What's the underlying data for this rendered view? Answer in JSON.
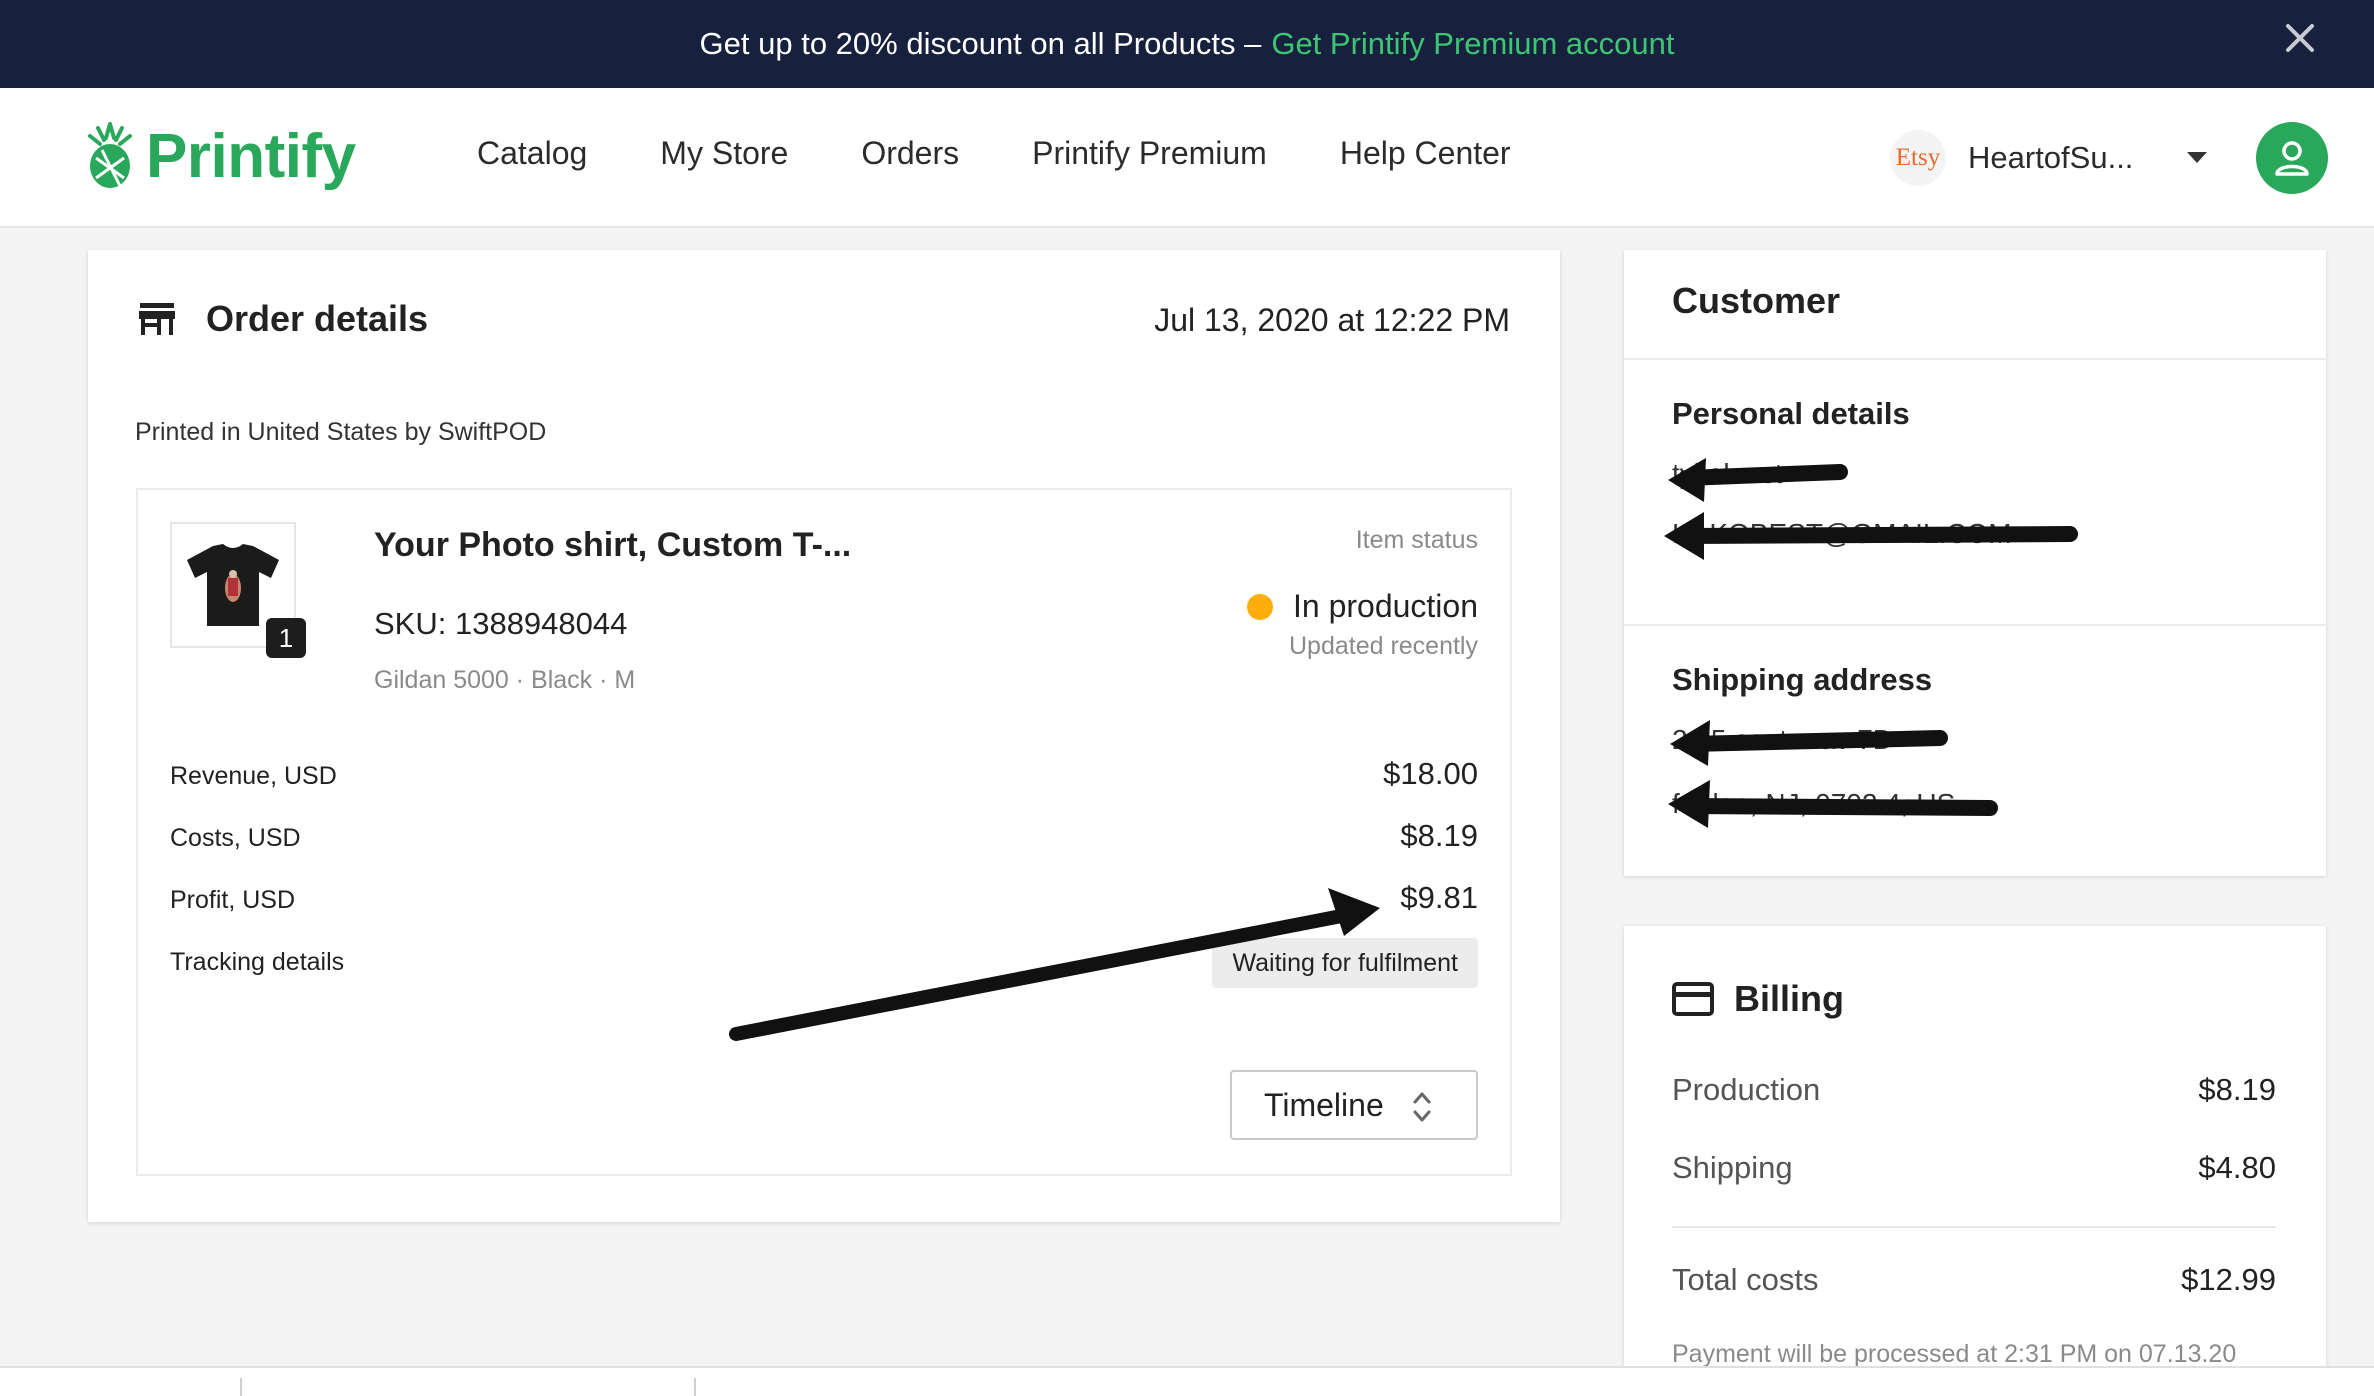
{
  "promo": {
    "text": "Get up to 20% discount on all Products –",
    "link": "Get Printify Premium account"
  },
  "header": {
    "logo": "Printify",
    "nav": [
      "Catalog",
      "My Store",
      "Orders",
      "Printify Premium",
      "Help Center"
    ],
    "store_badge": "Etsy",
    "store_name": "HeartofSu..."
  },
  "order": {
    "title": "Order details",
    "date": "Jul 13, 2020 at 12:22 PM",
    "printed_by": "Printed in United States by SwiftPOD",
    "item": {
      "name": "Your Photo shirt, Custom T-...",
      "sku": "SKU: 1388948044",
      "variant": "Gildan 5000 · Black · M",
      "quantity": "1",
      "status_label": "Item status",
      "status": "In production",
      "status_updated": "Updated recently"
    },
    "financials": {
      "revenue_label": "Revenue, USD",
      "revenue": "$18.00",
      "costs_label": "Costs, USD",
      "costs": "$8.19",
      "profit_label": "Profit, USD",
      "profit": "$9.81",
      "tracking_label": "Tracking details",
      "tracking_status": "Waiting for fulfilment"
    },
    "timeline_label": "Timeline"
  },
  "customer": {
    "title": "Customer",
    "personal_title": "Personal details",
    "name_redacted": "tyl el..est",
    "email_redacted": "KAKOBEST@GMAIL.COM",
    "shipping_title": "Shipping address",
    "address_line1_redacted": "2 55 center av 7D",
    "address_line2_redacted": "f rt lee, NJ, 0702 4, US"
  },
  "billing": {
    "title": "Billing",
    "production_label": "Production",
    "production": "$8.19",
    "shipping_label": "Shipping",
    "shipping": "$4.80",
    "total_label": "Total costs",
    "total": "$12.99",
    "note": "Payment will be processed at 2:31 PM on 07.13.20"
  },
  "colors": {
    "brand_green": "#29a75a",
    "banner_bg": "#17213d",
    "status_dot": "#ffad0d"
  }
}
